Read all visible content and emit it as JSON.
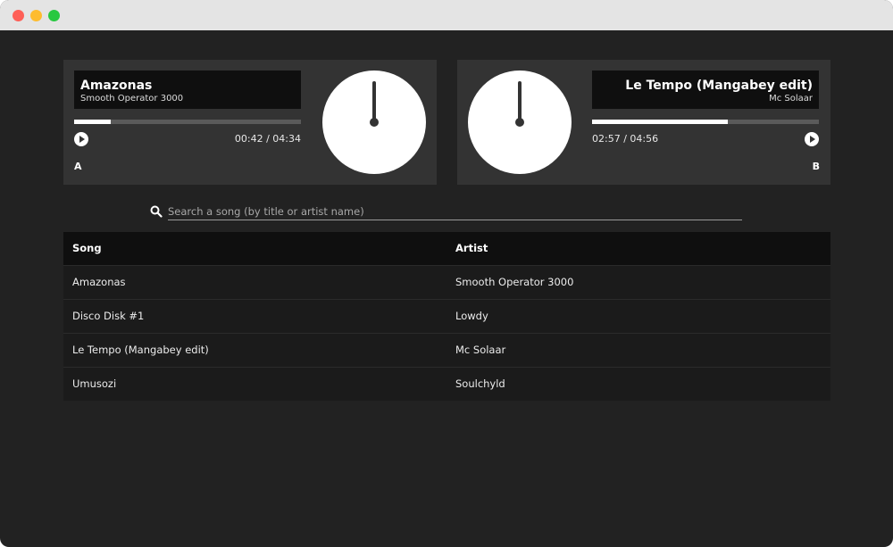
{
  "window": {
    "controls": [
      "close",
      "minimize",
      "maximize"
    ]
  },
  "deck_a": {
    "title": "Amazonas",
    "artist": "Smooth Operator 3000",
    "time": "00:42 / 04:34",
    "progress": 0.16,
    "letter": "A",
    "play_icon": "play-icon",
    "dial_icon": "turntable-icon"
  },
  "deck_b": {
    "title": "Le Tempo (Mangabey edit)",
    "artist": "Mc Solaar",
    "time": "02:57 / 04:56",
    "progress": 0.6,
    "letter": "B",
    "play_icon": "play-icon",
    "dial_icon": "turntable-icon"
  },
  "search": {
    "placeholder": "Search a song (by title or artist name)",
    "value": "",
    "icon": "search-icon"
  },
  "table": {
    "headers": {
      "song": "Song",
      "artist": "Artist"
    },
    "rows": [
      {
        "song": "Amazonas",
        "artist": "Smooth Operator 3000"
      },
      {
        "song": "Disco Disk #1",
        "artist": "Lowdy"
      },
      {
        "song": "Le Tempo (Mangabey edit)",
        "artist": "Mc Solaar"
      },
      {
        "song": "Umusozi",
        "artist": "Soulchyld"
      }
    ]
  },
  "colors": {
    "background": "#222222",
    "deck": "#333333",
    "panel": "#0f0f0f",
    "accent": "#ffffff"
  }
}
